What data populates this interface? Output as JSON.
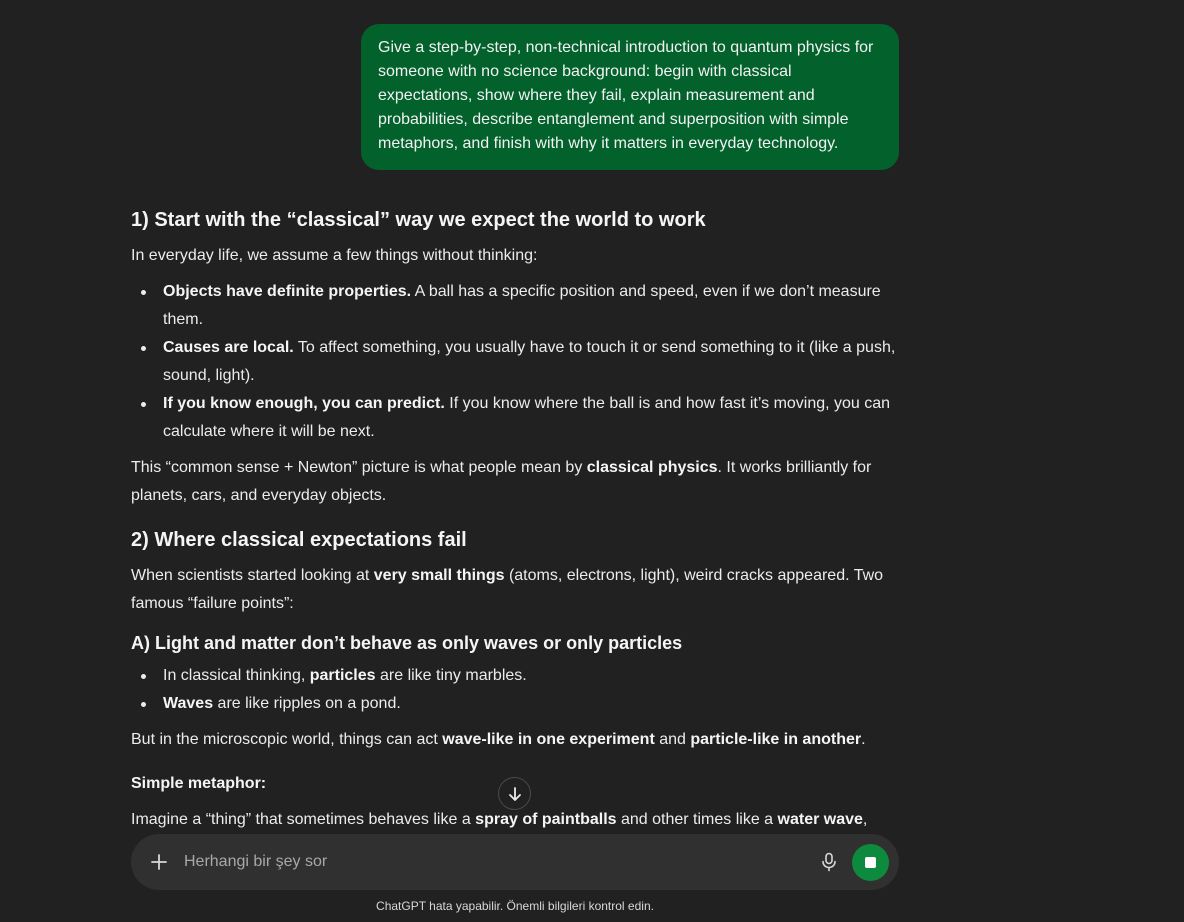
{
  "user_message": "Give a step-by-step, non-technical introduction to quantum physics for someone with no science background: begin with classical expectations, show where they fail, explain measurement and probabilities, describe entanglement and superposition with simple metaphors, and finish with why it matters in everyday technology.",
  "response": {
    "s1": {
      "heading": "1) Start with the “classical” way we expect the world to work",
      "intro": "In everyday life, we assume a few things without thinking:",
      "bullets": [
        {
          "bold": "Objects have definite properties.",
          "text": " A ball has a specific position and speed, even if we don’t measure them."
        },
        {
          "bold": "Causes are local.",
          "text": " To affect something, you usually have to touch it or send something to it (like a push, sound, light)."
        },
        {
          "bold": "If you know enough, you can predict.",
          "text": " If you know where the ball is and how fast it’s moving, you can calculate where it will be next."
        }
      ],
      "closing_a": "This “common sense + Newton” picture is what people mean by ",
      "closing_bold": "classical physics",
      "closing_b": ". It works brilliantly for planets, cars, and everyday objects."
    },
    "s2": {
      "heading": "2) Where classical expectations fail",
      "intro_a": "When scientists started looking at ",
      "intro_bold": "very small things",
      "intro_b": " (atoms, electrons, light), weird cracks appeared. Two famous “failure points”:",
      "subA": {
        "heading": "A) Light and matter don’t behave as only waves or only particles",
        "b1_a": "In classical thinking, ",
        "b1_bold": "particles",
        "b1_b": " are like tiny marbles.",
        "b2_bold": "Waves",
        "b2_b": " are like ripples on a pond.",
        "p_a": "But in the microscopic world, things can act ",
        "p_bold1": "wave-like in one experiment",
        "p_mid": " and ",
        "p_bold2": "particle-like in another",
        "p_end": "."
      },
      "metaphor_title": "Simple metaphor:",
      "metaphor_a": "Imagine a “thing” that sometimes behaves like a ",
      "metaphor_bold1": "spray of paintballs",
      "metaphor_mid": " and other times like a ",
      "metaphor_bold2": "water wave",
      "metaphor_end": ","
    }
  },
  "composer": {
    "placeholder": "Herhangi bir şey sor"
  },
  "disclaimer": "ChatGPT hata yapabilir. Önemli bilgileri kontrol edin.",
  "icons": {
    "plus": "plus-icon",
    "mic": "microphone-icon",
    "stop": "stop-icon",
    "scroll": "arrow-down-icon"
  },
  "colors": {
    "background": "#212121",
    "user_bubble": "#03612c",
    "composer": "#303030",
    "stop_button": "#0d8a3d"
  }
}
